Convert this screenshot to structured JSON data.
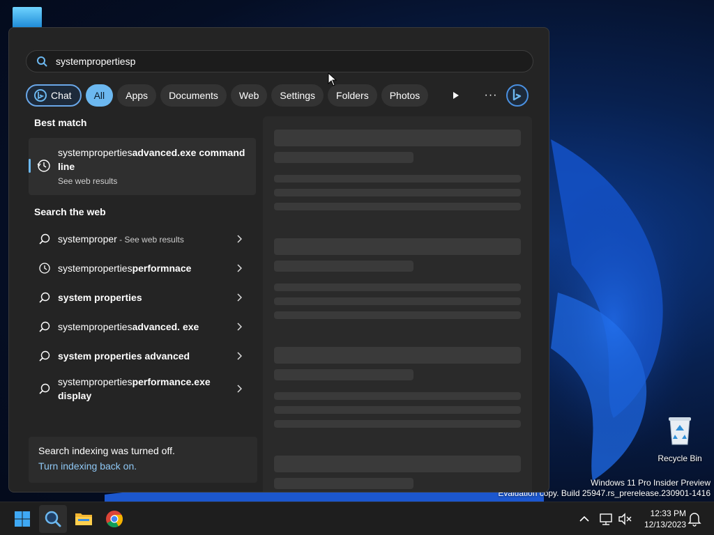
{
  "desktop": {
    "recycle_bin_label": "Recycle Bin",
    "watermark_line1": "Windows 11 Pro Insider Preview",
    "watermark_line2": "Evaluation copy. Build 25947.rs_prerelease.230901-1416"
  },
  "search": {
    "query": "systempropertiesp",
    "icon": "search-icon"
  },
  "filters": {
    "chat": "Chat",
    "items": [
      "All",
      "Apps",
      "Documents",
      "Web",
      "Settings",
      "Folders",
      "Photos"
    ],
    "active": "All",
    "more": "···"
  },
  "best_match": {
    "heading": "Best match",
    "title_regular": "systemproperties",
    "title_bold": "advanced.exe command line",
    "subtitle": "See web results",
    "icon": "history-icon"
  },
  "search_web": {
    "heading": "Search the web",
    "items": [
      {
        "icon": "search-icon",
        "regular": "systemproper",
        "bold": "",
        "hint": " - See web results"
      },
      {
        "icon": "history-icon",
        "regular": "systemproperties",
        "bold": "performnace",
        "hint": ""
      },
      {
        "icon": "search-icon",
        "regular": "",
        "bold": "system properties",
        "hint": ""
      },
      {
        "icon": "search-icon",
        "regular": "systemproperties",
        "bold": "advanced. exe",
        "hint": ""
      },
      {
        "icon": "search-icon",
        "regular": "",
        "bold": "system properties advanced",
        "hint": ""
      },
      {
        "icon": "search-icon",
        "regular": "systemproperties",
        "bold": "performance.exe display",
        "hint": ""
      }
    ]
  },
  "indexing": {
    "message": "Search indexing was turned off.",
    "link": "Turn indexing back on."
  },
  "taskbar": {
    "time": "12:33 PM",
    "date": "12/13/2023"
  },
  "colors": {
    "accent": "#6cb8f0",
    "panel_bg": "#242424",
    "link": "#8fc8f5"
  }
}
